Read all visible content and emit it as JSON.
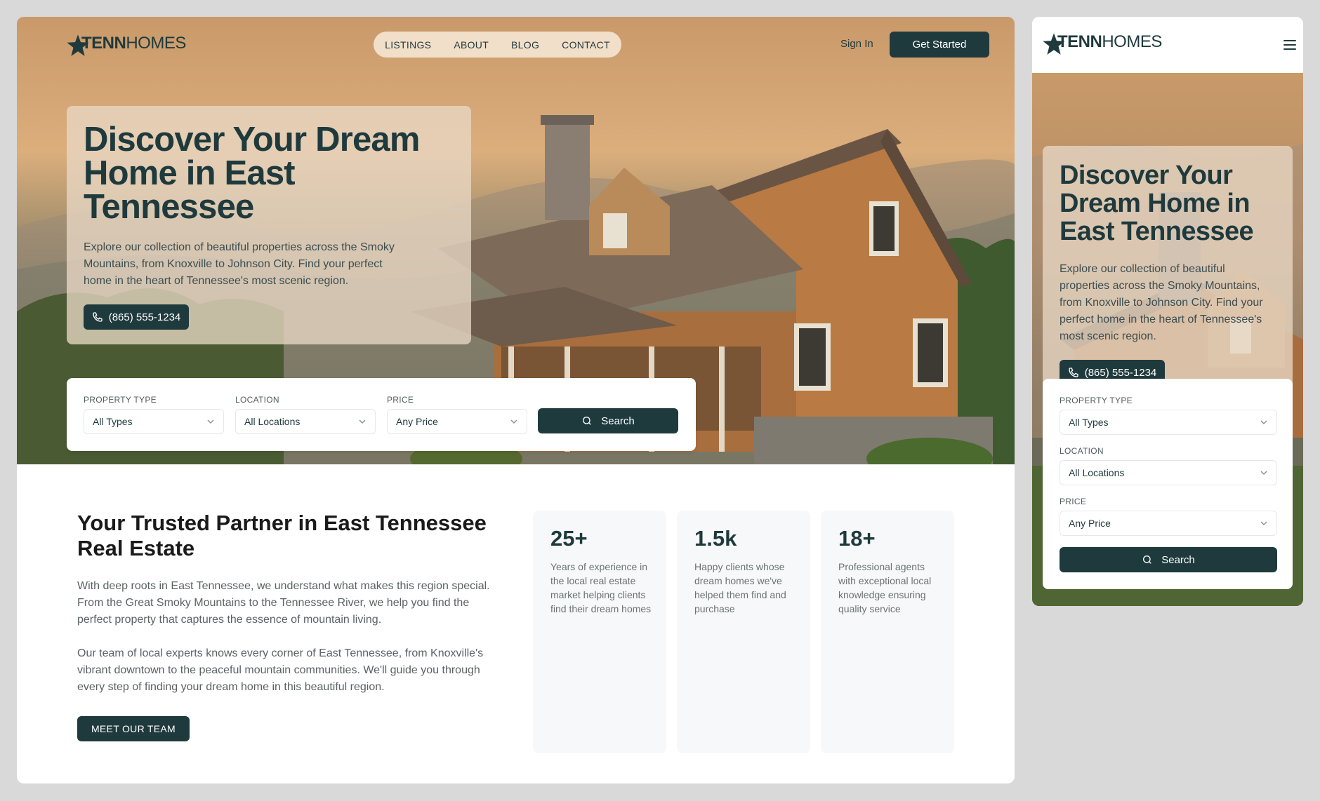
{
  "brand": {
    "logo_bold": "TENN",
    "logo_regular": "HOMES"
  },
  "nav": {
    "links": [
      "LISTINGS",
      "ABOUT",
      "BLOG",
      "CONTACT"
    ],
    "sign_in": "Sign In",
    "cta": "Get Started"
  },
  "hero": {
    "title": "Discover Your Dream Home in East Tennessee",
    "description": "Explore our collection of beautiful properties across the Smoky Mountains, from Knoxville to Johnson City. Find your perfect home in the heart of Tennessee's most scenic region.",
    "phone": "(865) 555-1234"
  },
  "search": {
    "property_type": {
      "label": "PROPERTY TYPE",
      "value": "All Types"
    },
    "location": {
      "label": "LOCATION",
      "value": "All Locations"
    },
    "price": {
      "label": "PRICE",
      "value": "Any Price"
    },
    "button": "Search"
  },
  "about": {
    "title": "Your Trusted Partner in East Tennessee Real Estate",
    "paragraph1": "With deep roots in East Tennessee, we understand what makes this region special. From the Great Smoky Mountains to the Tennessee River, we help you find the perfect property that captures the essence of mountain living.",
    "paragraph2": "Our team of local experts knows every corner of East Tennessee, from Knoxville's vibrant downtown to the peaceful mountain communities. We'll guide you through every step of finding your dream home in this beautiful region.",
    "button": "MEET OUR TEAM"
  },
  "stats": [
    {
      "value": "25+",
      "description": "Years of experience in the local real estate market helping clients find their dream homes"
    },
    {
      "value": "1.5k",
      "description": "Happy clients whose dream homes we've helped them find and purchase"
    },
    {
      "value": "18+",
      "description": "Professional agents with exceptional local knowledge ensuring quality service"
    }
  ],
  "colors": {
    "primary": "#1f3a3d",
    "frame_bg": "#d9d9d9",
    "card_bg": "#f7f8f9"
  }
}
